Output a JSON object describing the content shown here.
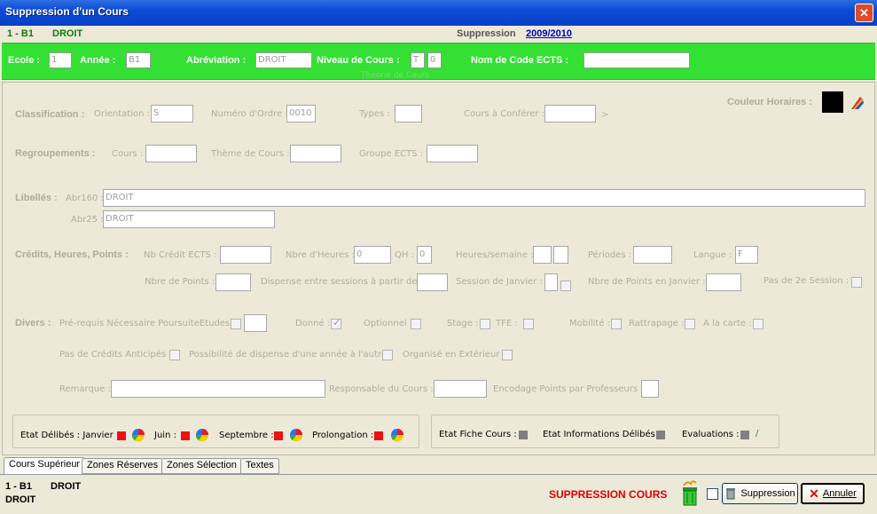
{
  "window": {
    "title": "Suppression d'un Cours",
    "close_glyph": "✕"
  },
  "header": {
    "code": "1 - B1",
    "name": "DROIT",
    "mode_label": "Suppression",
    "year": "2009/2010"
  },
  "band": {
    "ecole_label": "Ecole :",
    "ecole_value": "1",
    "annee_label": "Année :",
    "annee_value": "B1",
    "abrev_label": "Abréviation :",
    "abrev_value": "DROIT",
    "niveau_label": "Niveau de Cours :",
    "niveau_value1": "T",
    "niveau_value2": "0",
    "niveau_sub": "Théorie de Cours",
    "ects_label": "Nom de Code ECTS :",
    "ects_value": ""
  },
  "classification": {
    "title": "Classification :",
    "orientation_label": "Orientation :",
    "orientation_value": "S",
    "ordre_label": "Numéro d'Ordre :",
    "ordre_value": "0010",
    "types_label": "Types :",
    "types_value": "",
    "conferer_label": "Cours à Conférer :",
    "conferer_value": "",
    "conferer_arrow": ">",
    "couleur_label": "Couleur Horaires :"
  },
  "regroupements": {
    "title": "Regroupements :",
    "cours_label": "Cours :",
    "theme_label": "Thème de Cours :",
    "groupe_label": "Groupe ECTS :"
  },
  "libelles": {
    "title": "Libellés :",
    "abr160_label": "Abr160 :",
    "abr160_value": "DROIT",
    "abr25_label": "Abr25 :",
    "abr25_value": "DROIT"
  },
  "credits": {
    "title": "Crédits, Heures, Points :",
    "nb_ects_label": "Nb Crédit ECTS :",
    "nbre_heures_label": "Nbre d'Heures :",
    "nbre_heures_value": "0",
    "qh_label": "QH :",
    "qh_value": "0",
    "heures_sem_label": "Heures/semaine :",
    "periodes_label": "Périodes :",
    "langue_label": "Langue :",
    "langue_value": "F",
    "nbre_points_label": "Nbre de Points :",
    "dispense_label": "Dispense entre sessions à partir de :",
    "session_janvier_label": "Session de Janvier :",
    "points_janvier_label": "Nbre de Points en Janvier :",
    "pas_2e_label": "Pas de 2e Session :"
  },
  "divers": {
    "title": "Divers :",
    "prerequis_label": "Pré-requis Nécessaire PoursuiteEtudes :",
    "donne_label": "Donné :",
    "optionnel_label": "Optionnel :",
    "stage_label": "Stage :",
    "tfe_label": "TFE :",
    "mobilite_label": "Mobilité :",
    "rattrapage_label": "Rattrapage :",
    "a_la_carte_label": "A la carte :",
    "pas_credits_label": "Pas de Crédits Anticipés :",
    "possibilite_label": "Possibilité de dispense d'une année à l'autre :",
    "exterieur_label": "Organisé en Extérieur :",
    "remarque_label": "Remarque :",
    "responsable_label": "Responsable du Cours :",
    "encodage_label": "Encodage Points par Professeurs :"
  },
  "etat_delibes": {
    "label": "Etat Délibés : Janvier :",
    "juin_label": "Juin :",
    "septembre_label": "Septembre :",
    "prolongation_label": "Prolongation :"
  },
  "etat_fiche": {
    "fiche_label": "Etat Fiche Cours :",
    "infos_label": "Etat Informations Délibés :",
    "evaluations_label": "Evaluations :",
    "evaluations_mark": "/"
  },
  "tabs": [
    "Cours Supérieur",
    "Zones Réserves",
    "Zones Sélection",
    "Textes"
  ],
  "footer": {
    "code": "1 - B1",
    "name": "DROIT",
    "subname": "DROIT",
    "warning": "SUPPRESSION COURS",
    "suppression_button": "Suppression",
    "annuler_button": "Annuler"
  },
  "colors": {
    "band_green": "#33e033",
    "warning_red": "#e00000",
    "state_red": "#ee1111",
    "state_grey": "#808080"
  }
}
